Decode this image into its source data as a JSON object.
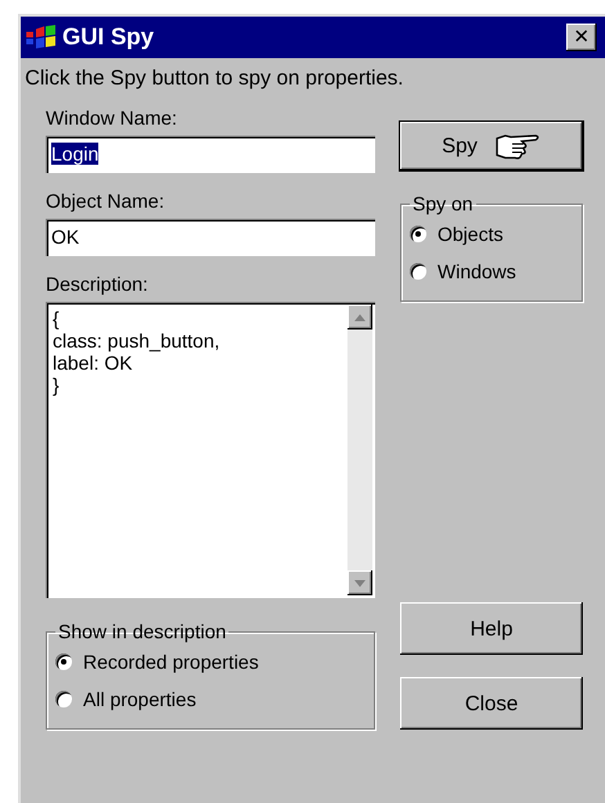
{
  "window": {
    "title": "GUI Spy",
    "close_glyph": "✕"
  },
  "instruction": "Click the Spy button to spy on properties.",
  "window_name": {
    "label": "Window Name:",
    "value": "Login",
    "value_selected": true
  },
  "spy_button": {
    "label": "Spy"
  },
  "object_name": {
    "label": "Object Name:",
    "value": "OK",
    "value_selected": false
  },
  "spy_on": {
    "title": "Spy on",
    "options": [
      {
        "label": "Objects",
        "selected": true
      },
      {
        "label": "Windows",
        "selected": false
      }
    ]
  },
  "description": {
    "label": "Description:",
    "lines": [
      "{",
      "class: push_button,",
      "label: OK",
      "}"
    ]
  },
  "show_in_description": {
    "title": "Show in description",
    "options": [
      {
        "label": "Recorded properties",
        "selected": true
      },
      {
        "label": "All properties",
        "selected": false
      }
    ]
  },
  "buttons": [
    "Help",
    "Close"
  ]
}
